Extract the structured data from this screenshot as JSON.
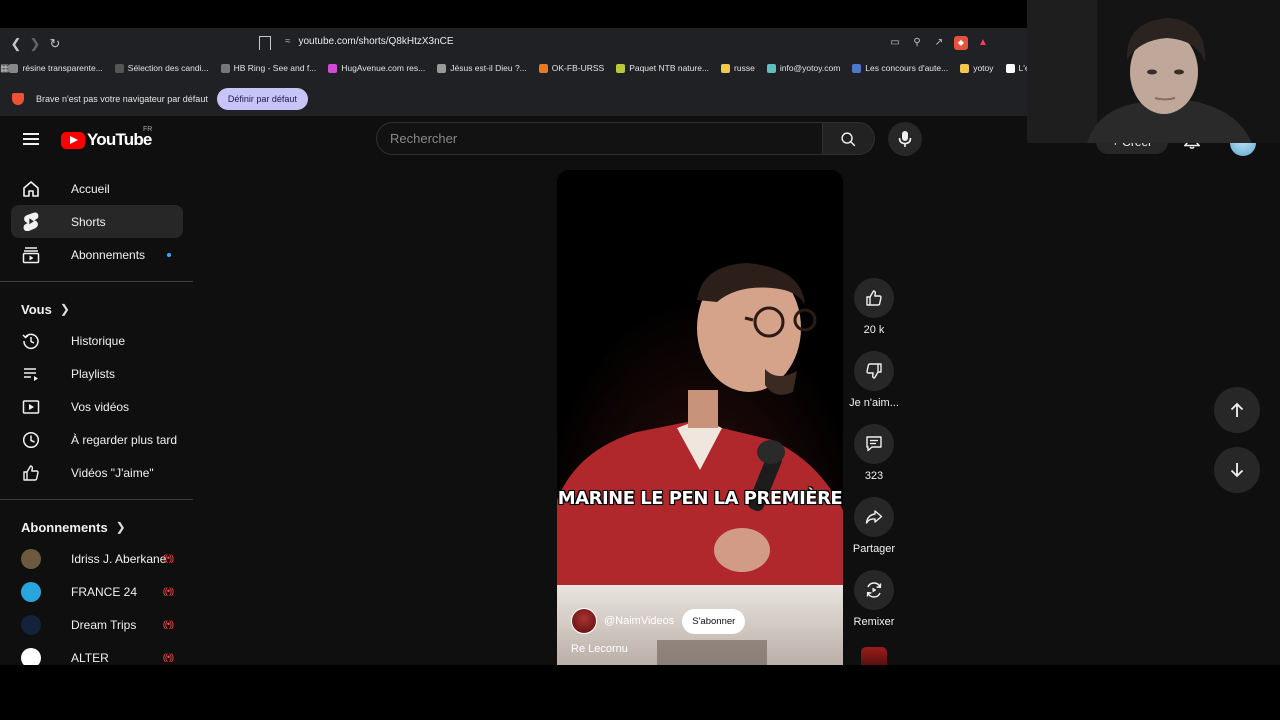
{
  "browser": {
    "url": "youtube.com/shorts/Q8kHtzX3nCE",
    "bookmarks": [
      {
        "label": "résine transparente...",
        "color": "#888888"
      },
      {
        "label": "Sélection des candi...",
        "color": "#555555"
      },
      {
        "label": "HB Ring - See and f...",
        "color": "#777777"
      },
      {
        "label": "HugAvenue.com res...",
        "color": "#d04ad6"
      },
      {
        "label": "Jésus est-il Dieu ?...",
        "color": "#999999"
      },
      {
        "label": "OK-FB-URSS",
        "color": "#e8791e"
      },
      {
        "label": "Paquet NTB nature...",
        "color": "#b7c93a"
      },
      {
        "label": "russe",
        "color": "#f2c94c"
      },
      {
        "label": "info@yotoy.com",
        "color": "#5bc0be"
      },
      {
        "label": "Les concours d'aute...",
        "color": "#4a79c7"
      },
      {
        "label": "yotoy",
        "color": "#f2c94c"
      },
      {
        "label": "L'e",
        "color": "#ffffff"
      }
    ],
    "infobar": {
      "message": "Brave n'est pas votre navigateur par défaut",
      "button": "Définir par défaut"
    }
  },
  "youtube": {
    "logo_text": "YouTube",
    "country_code": "FR",
    "search_placeholder": "Rechercher",
    "create_label": "+ Créer",
    "sidebar": {
      "main": [
        {
          "label": "Accueil",
          "icon": "home-icon",
          "active": false
        },
        {
          "label": "Shorts",
          "icon": "shorts-icon",
          "active": true
        },
        {
          "label": "Abonnements",
          "icon": "subscriptions-icon",
          "active": false,
          "new_dot": true
        }
      ],
      "you_heading": "Vous",
      "you": [
        {
          "label": "Historique",
          "icon": "history-icon"
        },
        {
          "label": "Playlists",
          "icon": "playlists-icon"
        },
        {
          "label": "Vos vidéos",
          "icon": "your-videos-icon"
        },
        {
          "label": "À regarder plus tard",
          "icon": "watch-later-icon"
        },
        {
          "label": "Vidéos \"J'aime\"",
          "icon": "liked-videos-icon"
        }
      ],
      "subs_heading": "Abonnements",
      "subscriptions": [
        {
          "label": "Idriss J. Aberkane",
          "avatar_color": "#6b5a3e",
          "live": true
        },
        {
          "label": "FRANCE 24",
          "avatar_color": "#2aa6de",
          "live": true
        },
        {
          "label": "Dream Trips",
          "avatar_color": "#12233b",
          "live": true
        },
        {
          "label": "ALTER",
          "avatar_color": "#ffffff",
          "live": true
        }
      ]
    },
    "short": {
      "caption": "MARINE LE PEN LA PREMIÈRE",
      "channel_handle": "@NaimVideos",
      "subscribe_label": "S'abonner",
      "title": "Re Lecornu",
      "likes": "20 k",
      "dislike_label": "Je n'aim...",
      "comments": "323",
      "share_label": "Partager",
      "remix_label": "Remixer"
    }
  }
}
